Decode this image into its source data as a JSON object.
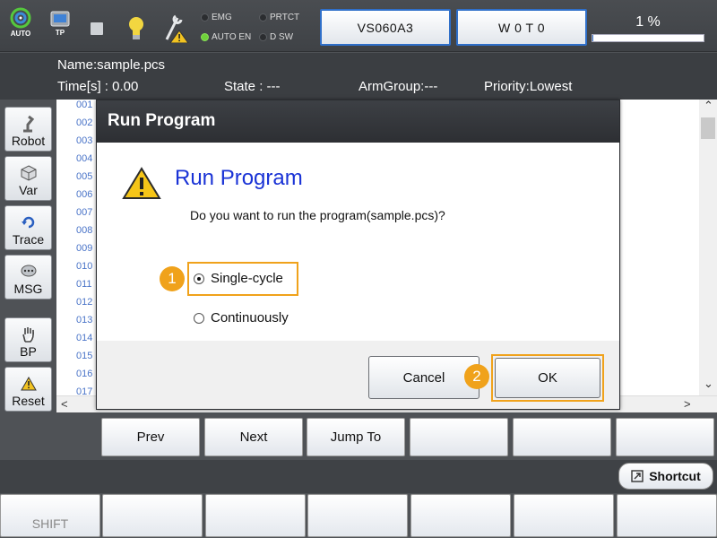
{
  "header": {
    "mode_label": "AUTO",
    "tp_label": "TP",
    "indicators": [
      {
        "label": "EMG",
        "active": false
      },
      {
        "label": "PRTCT",
        "active": false
      },
      {
        "label": "AUTO EN",
        "active": true
      },
      {
        "label": "D SW",
        "active": false
      }
    ],
    "robot_button": "VS060A3",
    "tool_button": "W 0 T 0",
    "speed_percent": "1 %",
    "speed_fraction": 0.01
  },
  "info": {
    "name": "Name:sample.pcs",
    "time": "Time[s] : 0.00",
    "state": "State : ---",
    "arm_group": "ArmGroup:---",
    "priority": "Priority:Lowest"
  },
  "left_tools": [
    {
      "label": "Robot",
      "icon": "robot-arm-icon"
    },
    {
      "label": "Var",
      "icon": "variable-icon"
    },
    {
      "label": "Trace",
      "icon": "trace-icon"
    },
    {
      "label": "MSG",
      "icon": "message-icon"
    },
    {
      "label": "BP",
      "icon": "hand-icon"
    },
    {
      "label": "Reset",
      "icon": "warning-icon"
    }
  ],
  "line_numbers": [
    "001",
    "002",
    "003",
    "004",
    "005",
    "006",
    "007",
    "008",
    "009",
    "010",
    "011",
    "012",
    "013",
    "014",
    "015",
    "016",
    "017"
  ],
  "dialog": {
    "title": "Run Program",
    "heading": "Run Program",
    "message": "Do you want to run the program(sample.pcs)?",
    "options": [
      {
        "label": "Single-cycle",
        "selected": true
      },
      {
        "label": "Continuously",
        "selected": false
      }
    ],
    "cancel_label": "Cancel",
    "ok_label": "OK",
    "callout_1": "1",
    "callout_2": "2"
  },
  "function_buttons": [
    "Prev",
    "Next",
    "Jump To",
    "",
    "",
    ""
  ],
  "shortcut_label": "Shortcut",
  "bottom_buttons": [
    "SHIFT",
    "",
    "",
    "",
    "",
    "",
    ""
  ],
  "colors": {
    "accent_blue": "#2f6fc9",
    "highlight_orange": "#f0a21b",
    "heading_blue": "#1a33d6"
  }
}
